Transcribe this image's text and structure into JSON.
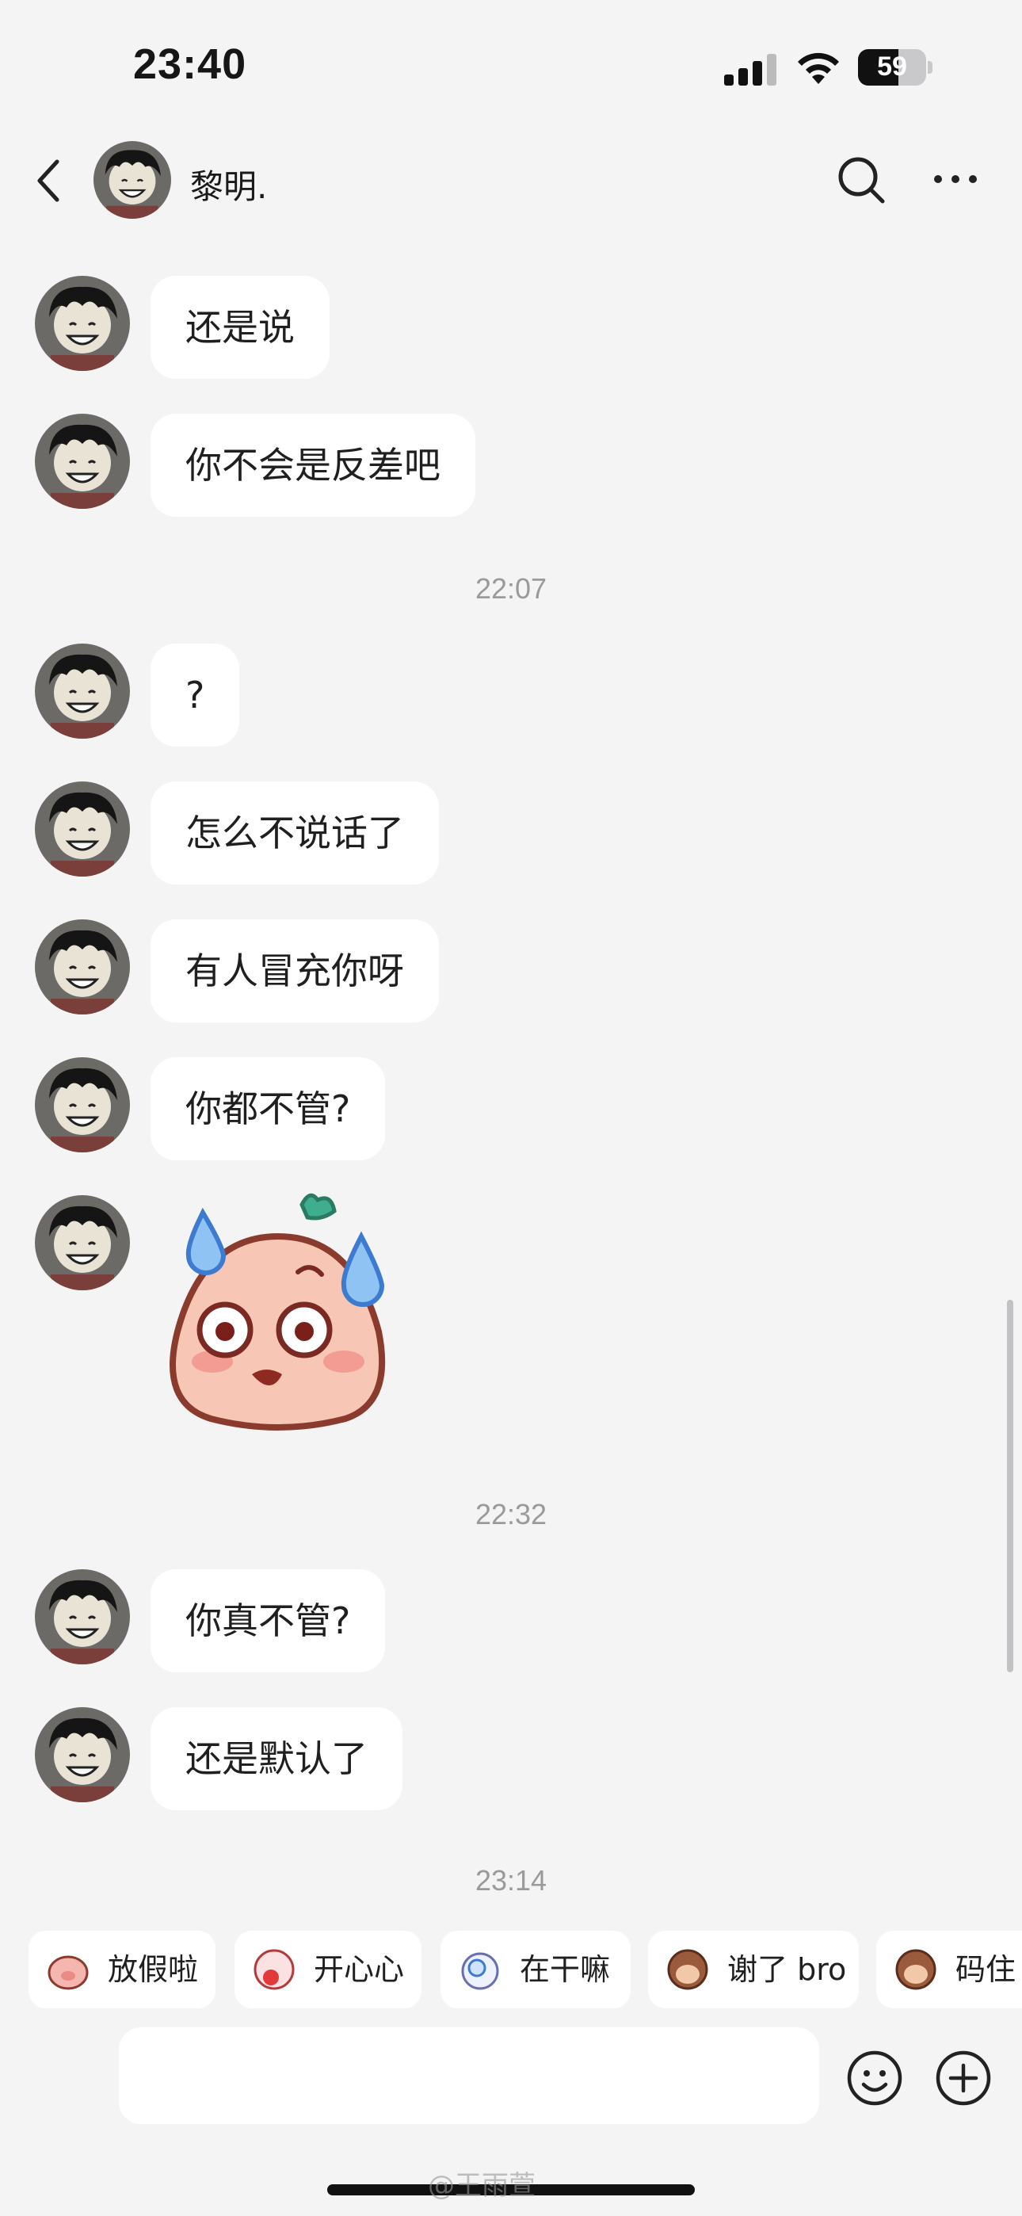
{
  "status_bar": {
    "time": "23:40",
    "battery": "59",
    "battery_level": 0.59
  },
  "header": {
    "contact_name": "黎明."
  },
  "messages": [
    {
      "text": "还是说"
    },
    {
      "text": "你不会是反差吧"
    },
    {
      "text": "?"
    },
    {
      "text": "怎么不说话了"
    },
    {
      "text": "有人冒充你呀"
    },
    {
      "text": "你都不管?"
    },
    {
      "text": "你真不管?"
    },
    {
      "text": "还是默认了"
    }
  ],
  "timestamps": [
    "22:07",
    "22:32",
    "23:14"
  ],
  "quick_replies": [
    {
      "label": "放假啦"
    },
    {
      "label": "开心心"
    },
    {
      "label": "在干嘛"
    },
    {
      "label": "谢了 bro"
    },
    {
      "label": "码住"
    }
  ],
  "watermark": "@王雨萱",
  "colors": {
    "bubble": "#ffffff",
    "background": "#f4f4f5",
    "timestamp": "#9a9a9c"
  }
}
